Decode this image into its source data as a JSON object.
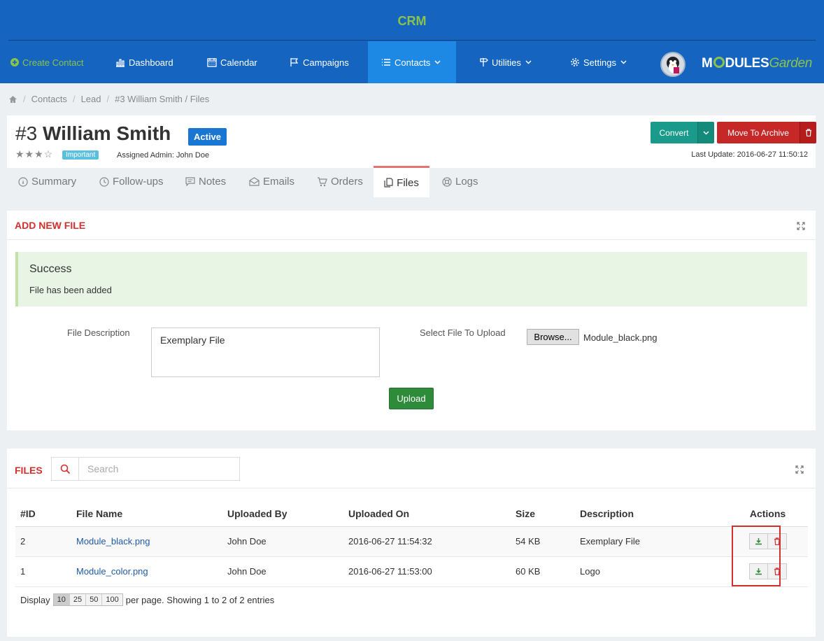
{
  "app": {
    "title": "CRM"
  },
  "nav": {
    "create_contact": "Create Contact",
    "items": [
      {
        "label": "Dashboard"
      },
      {
        "label": "Calendar"
      },
      {
        "label": "Campaigns"
      },
      {
        "label": "Contacts"
      },
      {
        "label": "Utilities"
      },
      {
        "label": "Settings"
      }
    ],
    "logo": {
      "part1": "M",
      "part2": "DULES",
      "part3": "Garden"
    }
  },
  "breadcrumb": [
    "Contacts",
    "Lead",
    "#3 William Smith / Files"
  ],
  "contact": {
    "id": "#3",
    "name": "William Smith",
    "status": "Active",
    "rating_stars": "★★★☆",
    "priority": "Important",
    "assigned_admin": "Assigned Admin: John Doe",
    "last_update": "Last Update: 2016-06-27 11:50:12",
    "convert_label": "Convert",
    "archive_label": "Move To Archive"
  },
  "tabs": [
    {
      "label": "Summary"
    },
    {
      "label": "Follow-ups"
    },
    {
      "label": "Notes"
    },
    {
      "label": "Emails"
    },
    {
      "label": "Orders"
    },
    {
      "label": "Files"
    },
    {
      "label": "Logs"
    }
  ],
  "add_file": {
    "title": "ADD NEW FILE",
    "alert_title": "Success",
    "alert_text": "File has been added",
    "description_label": "File Description",
    "description_value": "Exemplary File",
    "select_label": "Select File To Upload",
    "browse_label": "Browse...",
    "selected_file": "Module_black.png",
    "upload_label": "Upload"
  },
  "files": {
    "title": "FILES",
    "search_placeholder": "Search",
    "columns": [
      "#ID",
      "File Name",
      "Uploaded By",
      "Uploaded On",
      "Size",
      "Description",
      "Actions"
    ],
    "rows": [
      {
        "id": "2",
        "name": "Module_black.png",
        "by": "John Doe",
        "on": "2016-06-27 11:54:32",
        "size": "54 KB",
        "desc": "Exemplary File"
      },
      {
        "id": "1",
        "name": "Module_color.png",
        "by": "John Doe",
        "on": "2016-06-27 11:53:00",
        "size": "60 KB",
        "desc": "Logo"
      }
    ],
    "pager": {
      "display": "Display",
      "sizes": [
        "10",
        "25",
        "50",
        "100"
      ],
      "summary": "per page. Showing 1 to 2 of 2 entries"
    }
  },
  "colors": {
    "header": "#1565c0",
    "accent_green": "#8bc34a",
    "danger": "#d32f2f",
    "teal": "#1a9a8a"
  }
}
